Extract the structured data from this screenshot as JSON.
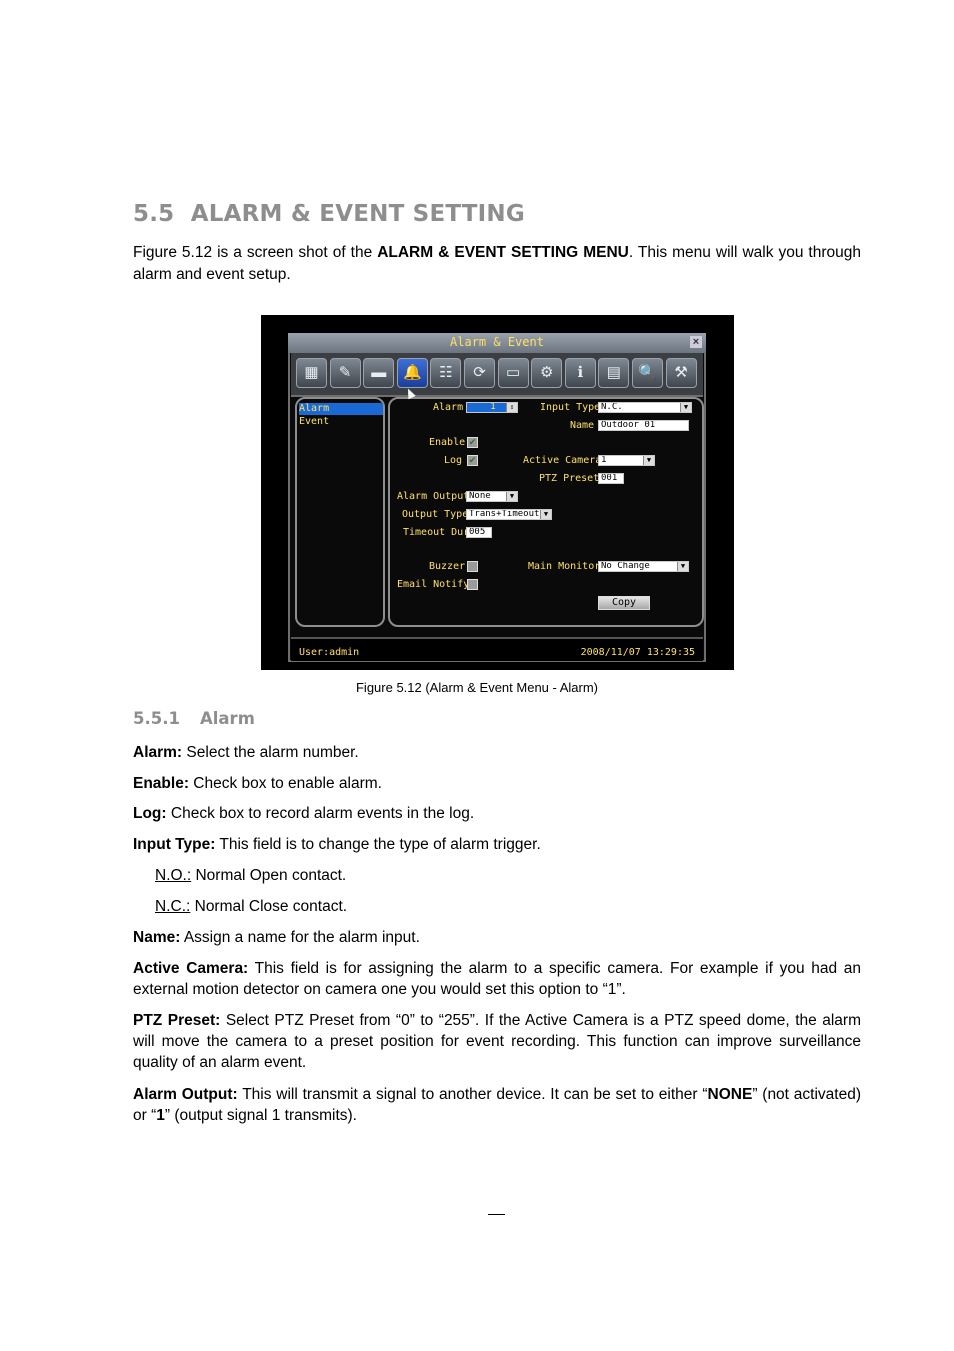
{
  "section": {
    "number": "5.5",
    "title": "ALARM & EVENT SETTING"
  },
  "intro": {
    "before": "Figure 5.12 is a screen shot of the ",
    "bold": "ALARM & EVENT SETTING MENU",
    "after": ". This menu will walk you through alarm and event setup."
  },
  "dvr": {
    "title": "Alarm & Event",
    "close": "×",
    "toolbar_icons": [
      "camera-grid-icon",
      "record-icon",
      "motion-icon",
      "alarm-bell-icon",
      "network-icon",
      "schedule-icon",
      "monitor-icon",
      "settings-gear-icon",
      "info-icon",
      "log-icon",
      "search-icon",
      "tools-icon"
    ],
    "toolbar_glyphs": [
      "▦",
      "✎",
      "▬",
      "🔔",
      "☷",
      "⟳",
      "▭",
      "⚙",
      "ℹ",
      "▤",
      "🔍",
      "⚒"
    ],
    "active_tool": 3,
    "left_menu": [
      "Alarm",
      "Event"
    ],
    "form": {
      "alarm_label": "Alarm",
      "alarm_value": "1",
      "enable_label": "Enable",
      "enable_checked": true,
      "log_label": "Log",
      "log_checked": true,
      "alarm_output_label": "Alarm Output",
      "alarm_output_value": "None",
      "output_type_label": "Output Type",
      "output_type_value": "Trans+Timeout",
      "timeout_dur_label": "Timeout Dur",
      "timeout_dur_value": "005",
      "buzzer_label": "Buzzer",
      "buzzer_checked": false,
      "email_notify_label": "Email Notify",
      "email_notify_checked": false,
      "input_type_label": "Input Type",
      "input_type_value": "N.C.",
      "name_label": "Name",
      "name_value": "Outdoor 01",
      "active_camera_label": "Active Camera",
      "active_camera_value": "1",
      "ptz_preset_label": "PTZ Preset",
      "ptz_preset_value": "001",
      "main_monitor_label": "Main Monitor",
      "main_monitor_value": "No Change",
      "copy_button": "Copy"
    },
    "status_user": "User:admin",
    "status_datetime": "2008/11/07  13:29:35"
  },
  "caption": "Figure 5.12 (Alarm & Event Menu - Alarm)",
  "subsection": {
    "number": "5.5.1",
    "title": "Alarm"
  },
  "items": [
    {
      "term": "Alarm:",
      "text": " Select the alarm number."
    },
    {
      "term": "Enable:",
      "text": " Check box to enable alarm."
    },
    {
      "term": "Log:",
      "text": " Check box to record alarm events in the log."
    },
    {
      "term": "Input Type:",
      "text": " This field is to change the type of alarm trigger."
    }
  ],
  "input_options": [
    {
      "term": "N.O.:",
      "text": " Normal Open contact."
    },
    {
      "term": "N.C.:",
      "text": " Normal Close contact."
    }
  ],
  "name_item": {
    "term": "Name:",
    "text": " Assign a name for the alarm input."
  },
  "active_camera_item": {
    "term": "Active Camera:",
    "text": " This field is for assigning the alarm to a specific camera. For example if you had an external motion detector on camera one you would set this option to “1”."
  },
  "ptz_item": {
    "term": "PTZ Preset:",
    "text": " Select PTZ Preset from “0” to “255”. If the Active Camera is a PTZ speed dome, the alarm will move the camera to a preset position for event recording. This function can improve surveillance quality of an alarm event."
  },
  "alarm_output_item": {
    "term": "Alarm Output:",
    "t1": " This will transmit a signal to another device. It can be set to either “",
    "b1": "NONE",
    "t2": "” (not activated) or “",
    "b2": "1",
    "t3": "” (output signal 1 transmits)."
  }
}
